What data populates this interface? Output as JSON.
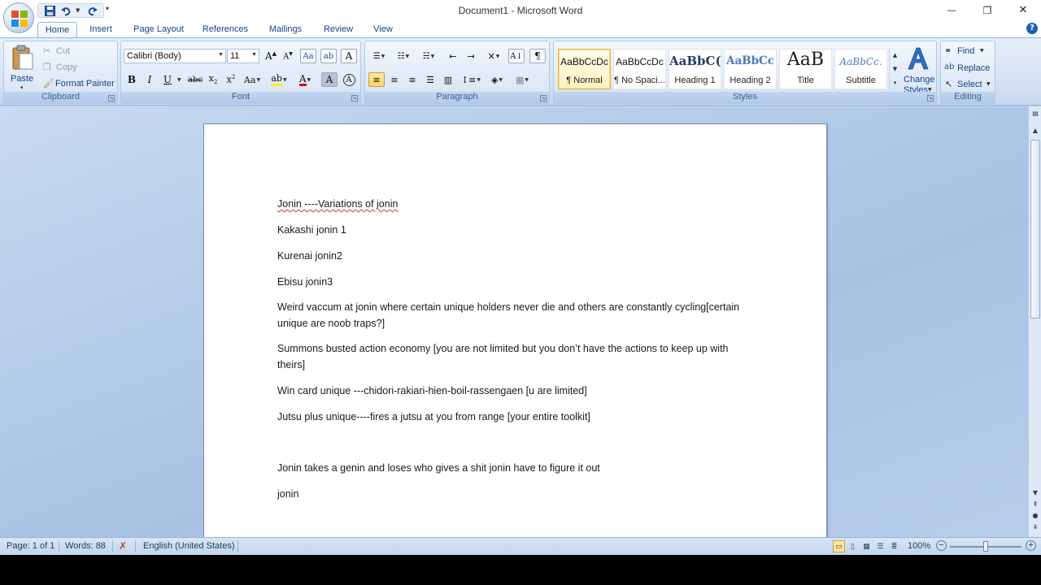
{
  "window": {
    "title": "Document1 - Microsoft Word",
    "minimize": "—",
    "restore": "❐",
    "close": "✕"
  },
  "tabs": [
    "Home",
    "Insert",
    "Page Layout",
    "References",
    "Mailings",
    "Review",
    "View"
  ],
  "ribbon": {
    "clipboard": {
      "label": "Clipboard",
      "paste": "Paste",
      "cut": "Cut",
      "copy": "Copy",
      "format_painter": "Format Painter"
    },
    "font": {
      "label": "Font",
      "font_name": "Calibri (Body)",
      "font_size": "11"
    },
    "paragraph": {
      "label": "Paragraph"
    },
    "styles": {
      "label": "Styles",
      "items": [
        {
          "preview": "AaBbCcDc",
          "name": "¶ Normal"
        },
        {
          "preview": "AaBbCcDc",
          "name": "¶ No Spaci..."
        },
        {
          "preview": "AaBbC(",
          "name": "Heading 1"
        },
        {
          "preview": "AaBbCc",
          "name": "Heading 2"
        },
        {
          "preview": "AaB",
          "name": "Title"
        },
        {
          "preview": "AaBbCc.",
          "name": "Subtitle"
        }
      ],
      "change_styles_line1": "Change",
      "change_styles_line2": "Styles"
    },
    "editing": {
      "label": "Editing",
      "find": "Find",
      "replace": "Replace",
      "select": "Select"
    }
  },
  "document": {
    "paragraphs": [
      "Jonin ----Variations of jonin",
      "Kakashi jonin 1",
      "Kurenai jonin2",
      "Ebisu jonin3",
      "Weird vaccum at jonin where certain unique holders never die and others are constantly cycling[certain unique are noob traps?]",
      "Summons busted action economy  [you are not limited but you don’t have the actions to keep up with theirs]",
      "Win card  unique ---chidori-rakiari-hien-boil-rassengaen [u are limited]",
      "Jutsu plus unique----fires a jutsu at you from range [your entire toolkit]",
      "Jonin takes a genin and loses who gives a shit jonin have to figure it out",
      "jonin"
    ]
  },
  "status": {
    "page": "Page: 1 of 1",
    "words": "Words: 88",
    "language": "English (United States)",
    "zoom": "100%",
    "zoom_level": 0.5
  },
  "colors": {
    "ribbon_bg": "#d5e2f3",
    "accent": "#15428b",
    "spell_error": "#dd3333"
  }
}
